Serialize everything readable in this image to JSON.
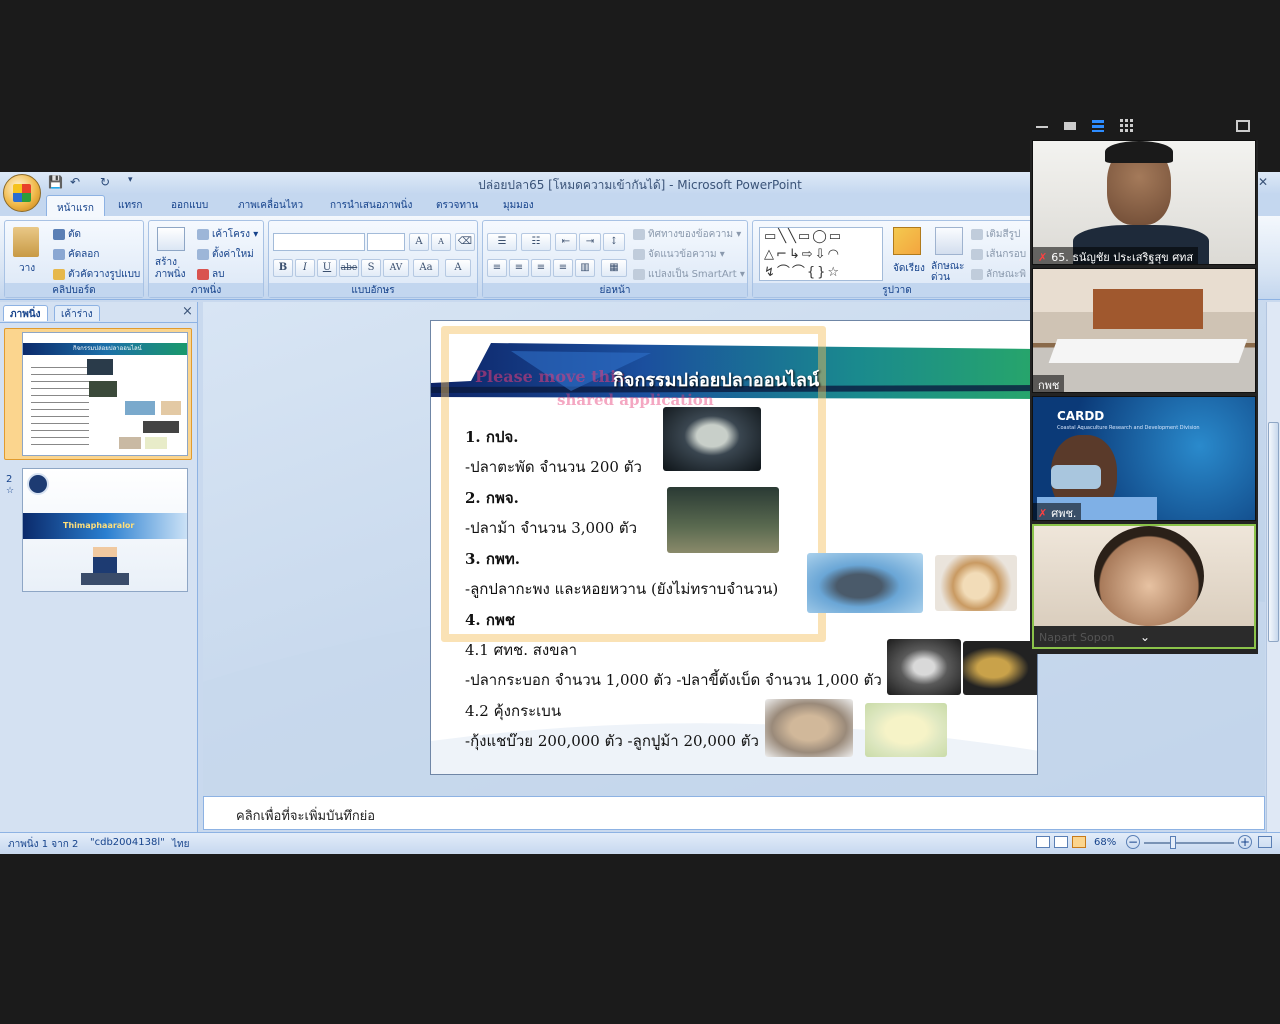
{
  "window": {
    "title": "ปล่อยปลา65 [โหมดความเข้ากันได้] - Microsoft PowerPoint",
    "close_glyph": "✕"
  },
  "ribbon_tabs": [
    "หน้าแรก",
    "แทรก",
    "ออกแบบ",
    "ภาพเคลื่อนไหว",
    "การนำเสนอภาพนิ่ง",
    "ตรวจทาน",
    "มุมมอง"
  ],
  "ribbon": {
    "clipboard": {
      "paste": "วาง",
      "cut": "ตัด",
      "copy": "คัดลอก",
      "format_painter": "ตัวคัดวางรูปแบบ",
      "label": "คลิปบอร์ด"
    },
    "slides": {
      "new_slide": "สร้าง ภาพนิ่ง",
      "layout": "เค้าโครง",
      "reset": "ตั้งค่าใหม่",
      "delete": "ลบ",
      "label": "ภาพนิ่ง"
    },
    "font": {
      "label": "แบบอักษร",
      "bold": "B",
      "italic": "I",
      "underline": "U",
      "strike": "abe",
      "shadow": "S",
      "spacing": "AV",
      "case": "Aa",
      "color": "A",
      "grow": "A",
      "shrink": "A"
    },
    "paragraph": {
      "text_direction": "ทิศทางของข้อความ",
      "align_text": "จัดแนวข้อความ",
      "smartart": "แปลงเป็น SmartArt",
      "label": "ย่อหน้า"
    },
    "drawing": {
      "arrange": "จัดเรียง",
      "quick_styles": "ลักษณะ ด่วน",
      "fill": "เติมสีรูป",
      "outline": "เส้นกรอบ",
      "effects": "ลักษณะพิ",
      "label": "รูปวาด"
    }
  },
  "left_panel": {
    "tab_slides": "ภาพนิ่ง",
    "tab_outline": "เค้าร่าง",
    "close": "×",
    "slides": [
      {
        "number": "1",
        "title": "กิจกรรมปล่อยปลาออนไลน์"
      },
      {
        "number": "2",
        "title": "Thimaphaaralor"
      }
    ]
  },
  "slide": {
    "title": "กิจกรรมปล่อยปลาออนไลน์",
    "overlay_text": "Please move this window to the shared application",
    "overlay_line1": "Please move this",
    "overlay_line2": "shared application",
    "lines": [
      {
        "text": "1. กปจ.",
        "bold": true
      },
      {
        "text": "-ปลาตะพัด จำนวน 200 ตัว",
        "bold": false
      },
      {
        "text": "2. กพจ.",
        "bold": true
      },
      {
        "text": "-ปลาม้า จำนวน 3,000 ตัว",
        "bold": false
      },
      {
        "text": "3. กพท.",
        "bold": true
      },
      {
        "text": "-ลูกปลากะพง และหอยหวาน (ยังไม่ทราบจำนวน)",
        "bold": false
      },
      {
        "text": "4. กพช",
        "bold": true
      },
      {
        "text": "4.1 ศทช. สงขลา",
        "bold": false
      },
      {
        "text": "-ปลากระบอก จำนวน 1,000 ตัว -ปลาขี้ตังเบ็ด จำนวน 1,000 ตัว",
        "bold": false
      },
      {
        "text": "4.2 คุ้งกระเบน",
        "bold": false
      },
      {
        "text": "-กุ้งแชบ๊วย 200,000 ตัว  -ลูกปูม้า 20,000 ตัว",
        "bold": false
      }
    ]
  },
  "notes": {
    "placeholder": "คลิกเพื่อที่จะเพิ่มบันทึกย่อ"
  },
  "status": {
    "slide_info": "ภาพนิ่ง 1 จาก 2",
    "theme": "\"cdb2004138l\"",
    "language": "ไทย",
    "zoom": "68%"
  },
  "zoom_panel": {
    "participants": [
      {
        "name": "65. ธนัญชัย ประเสริฐสุข ศทส",
        "muted": true
      },
      {
        "name": "กพช",
        "muted": false
      },
      {
        "name": "ศพช.",
        "muted": true
      },
      {
        "name": "Napart Sopon",
        "muted": false
      }
    ],
    "cardd_title": "CARDD",
    "cardd_sub": "Coastal Aquaculture Research and Development Division"
  },
  "colors": {
    "ribbon_text": "#15428b",
    "accent": "#f0b94a",
    "zoom_bg": "#232323"
  }
}
